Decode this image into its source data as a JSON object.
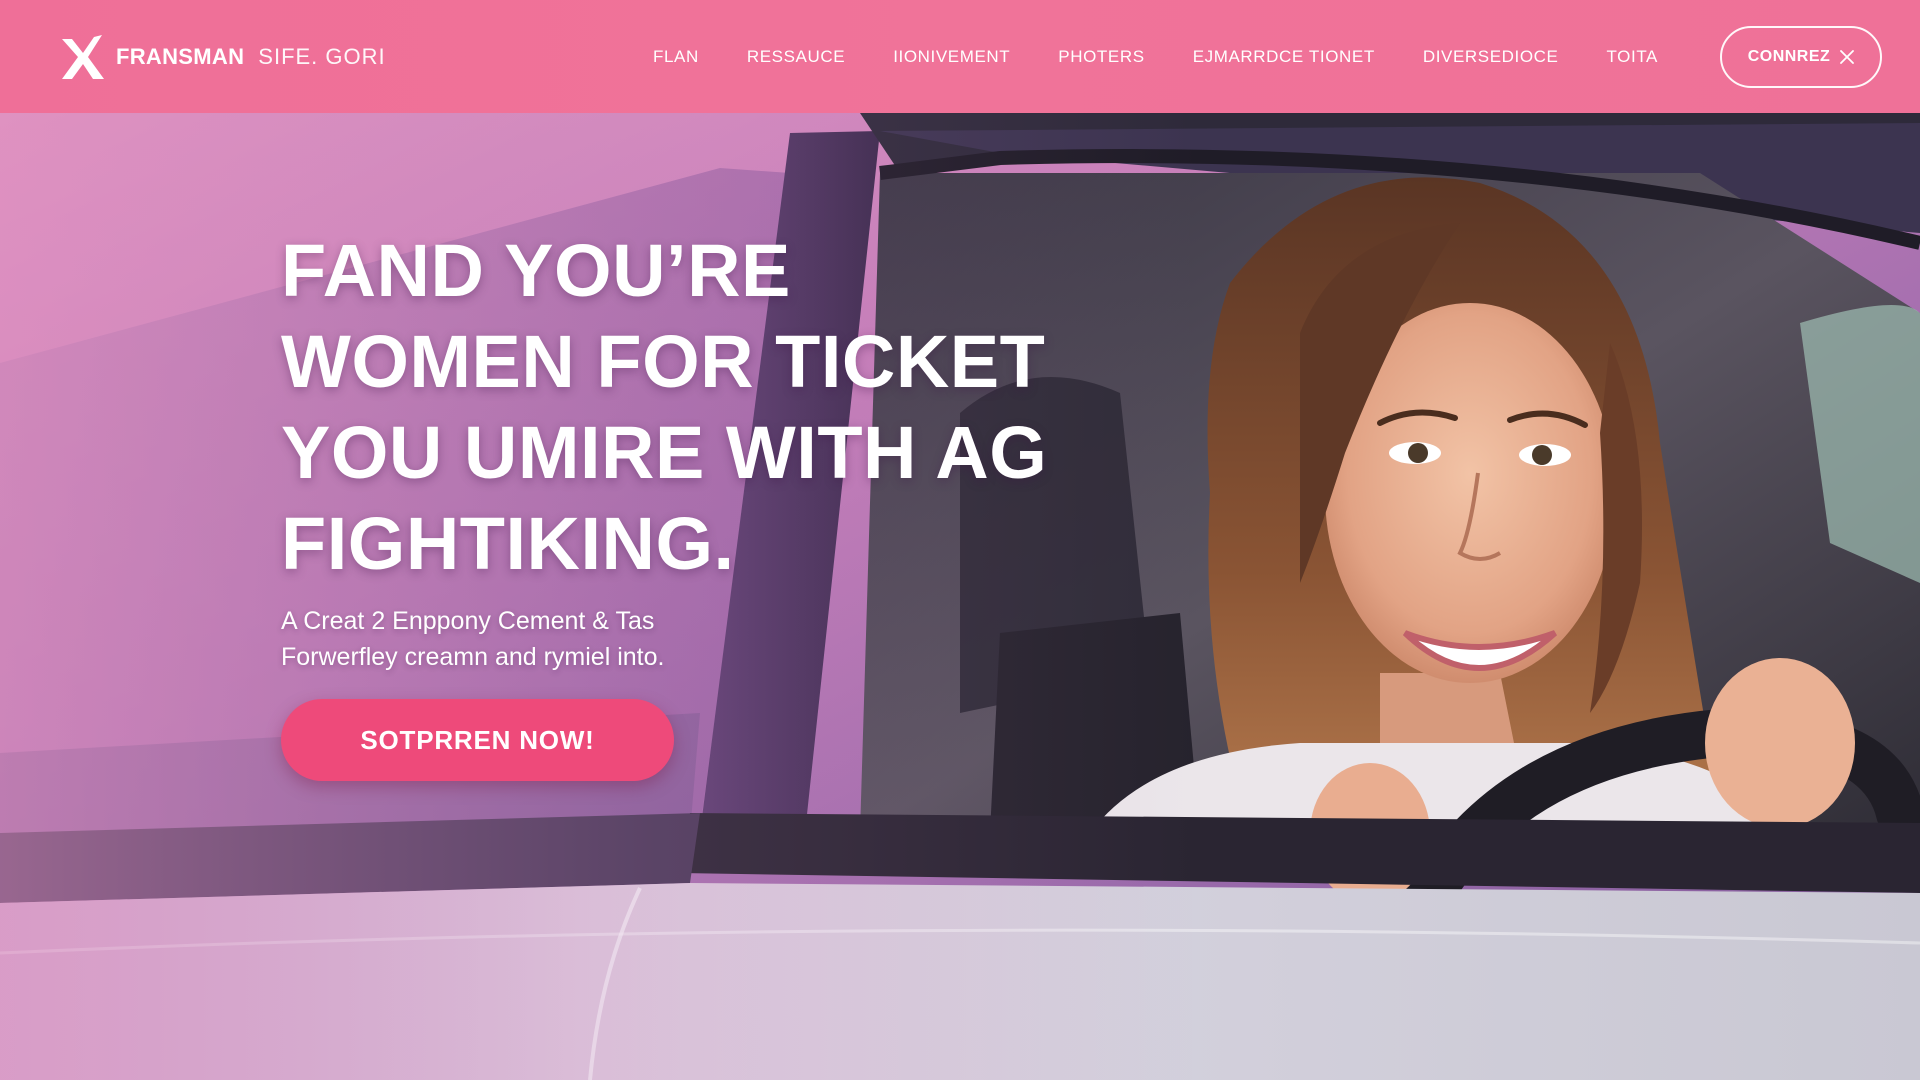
{
  "header": {
    "logo": {
      "bold": "FRANSMAN",
      "light": "SIFE. GORI",
      "icon": "x-logo-icon"
    },
    "nav": [
      {
        "label": "FLAN"
      },
      {
        "label": "RESSAUCE"
      },
      {
        "label": "IIONIVEMENT"
      },
      {
        "label": "PHOTERS"
      },
      {
        "label": "EJMARRDCE TIONET"
      },
      {
        "label": "DIVERSEDIOCE"
      },
      {
        "label": "TOITA"
      }
    ],
    "cta": {
      "label": "CONNREZ",
      "icon": "close-icon"
    }
  },
  "hero": {
    "headline": [
      "FAND YOU’RE",
      "WOMEN FOR TICKET",
      "YOU UMIRE WITH AG",
      "FIGHTIKING."
    ],
    "subtext": [
      "A Creat 2 Enppony Cement & Tas",
      "Forwerfley  creamn and rymiel into."
    ],
    "cta_label": "SOTPRREN NOW!",
    "image": "woman-driving-car-photo"
  },
  "colors": {
    "header_bg": "#f07399",
    "cta_main": "#ee4a7a",
    "text": "#ffffff"
  }
}
